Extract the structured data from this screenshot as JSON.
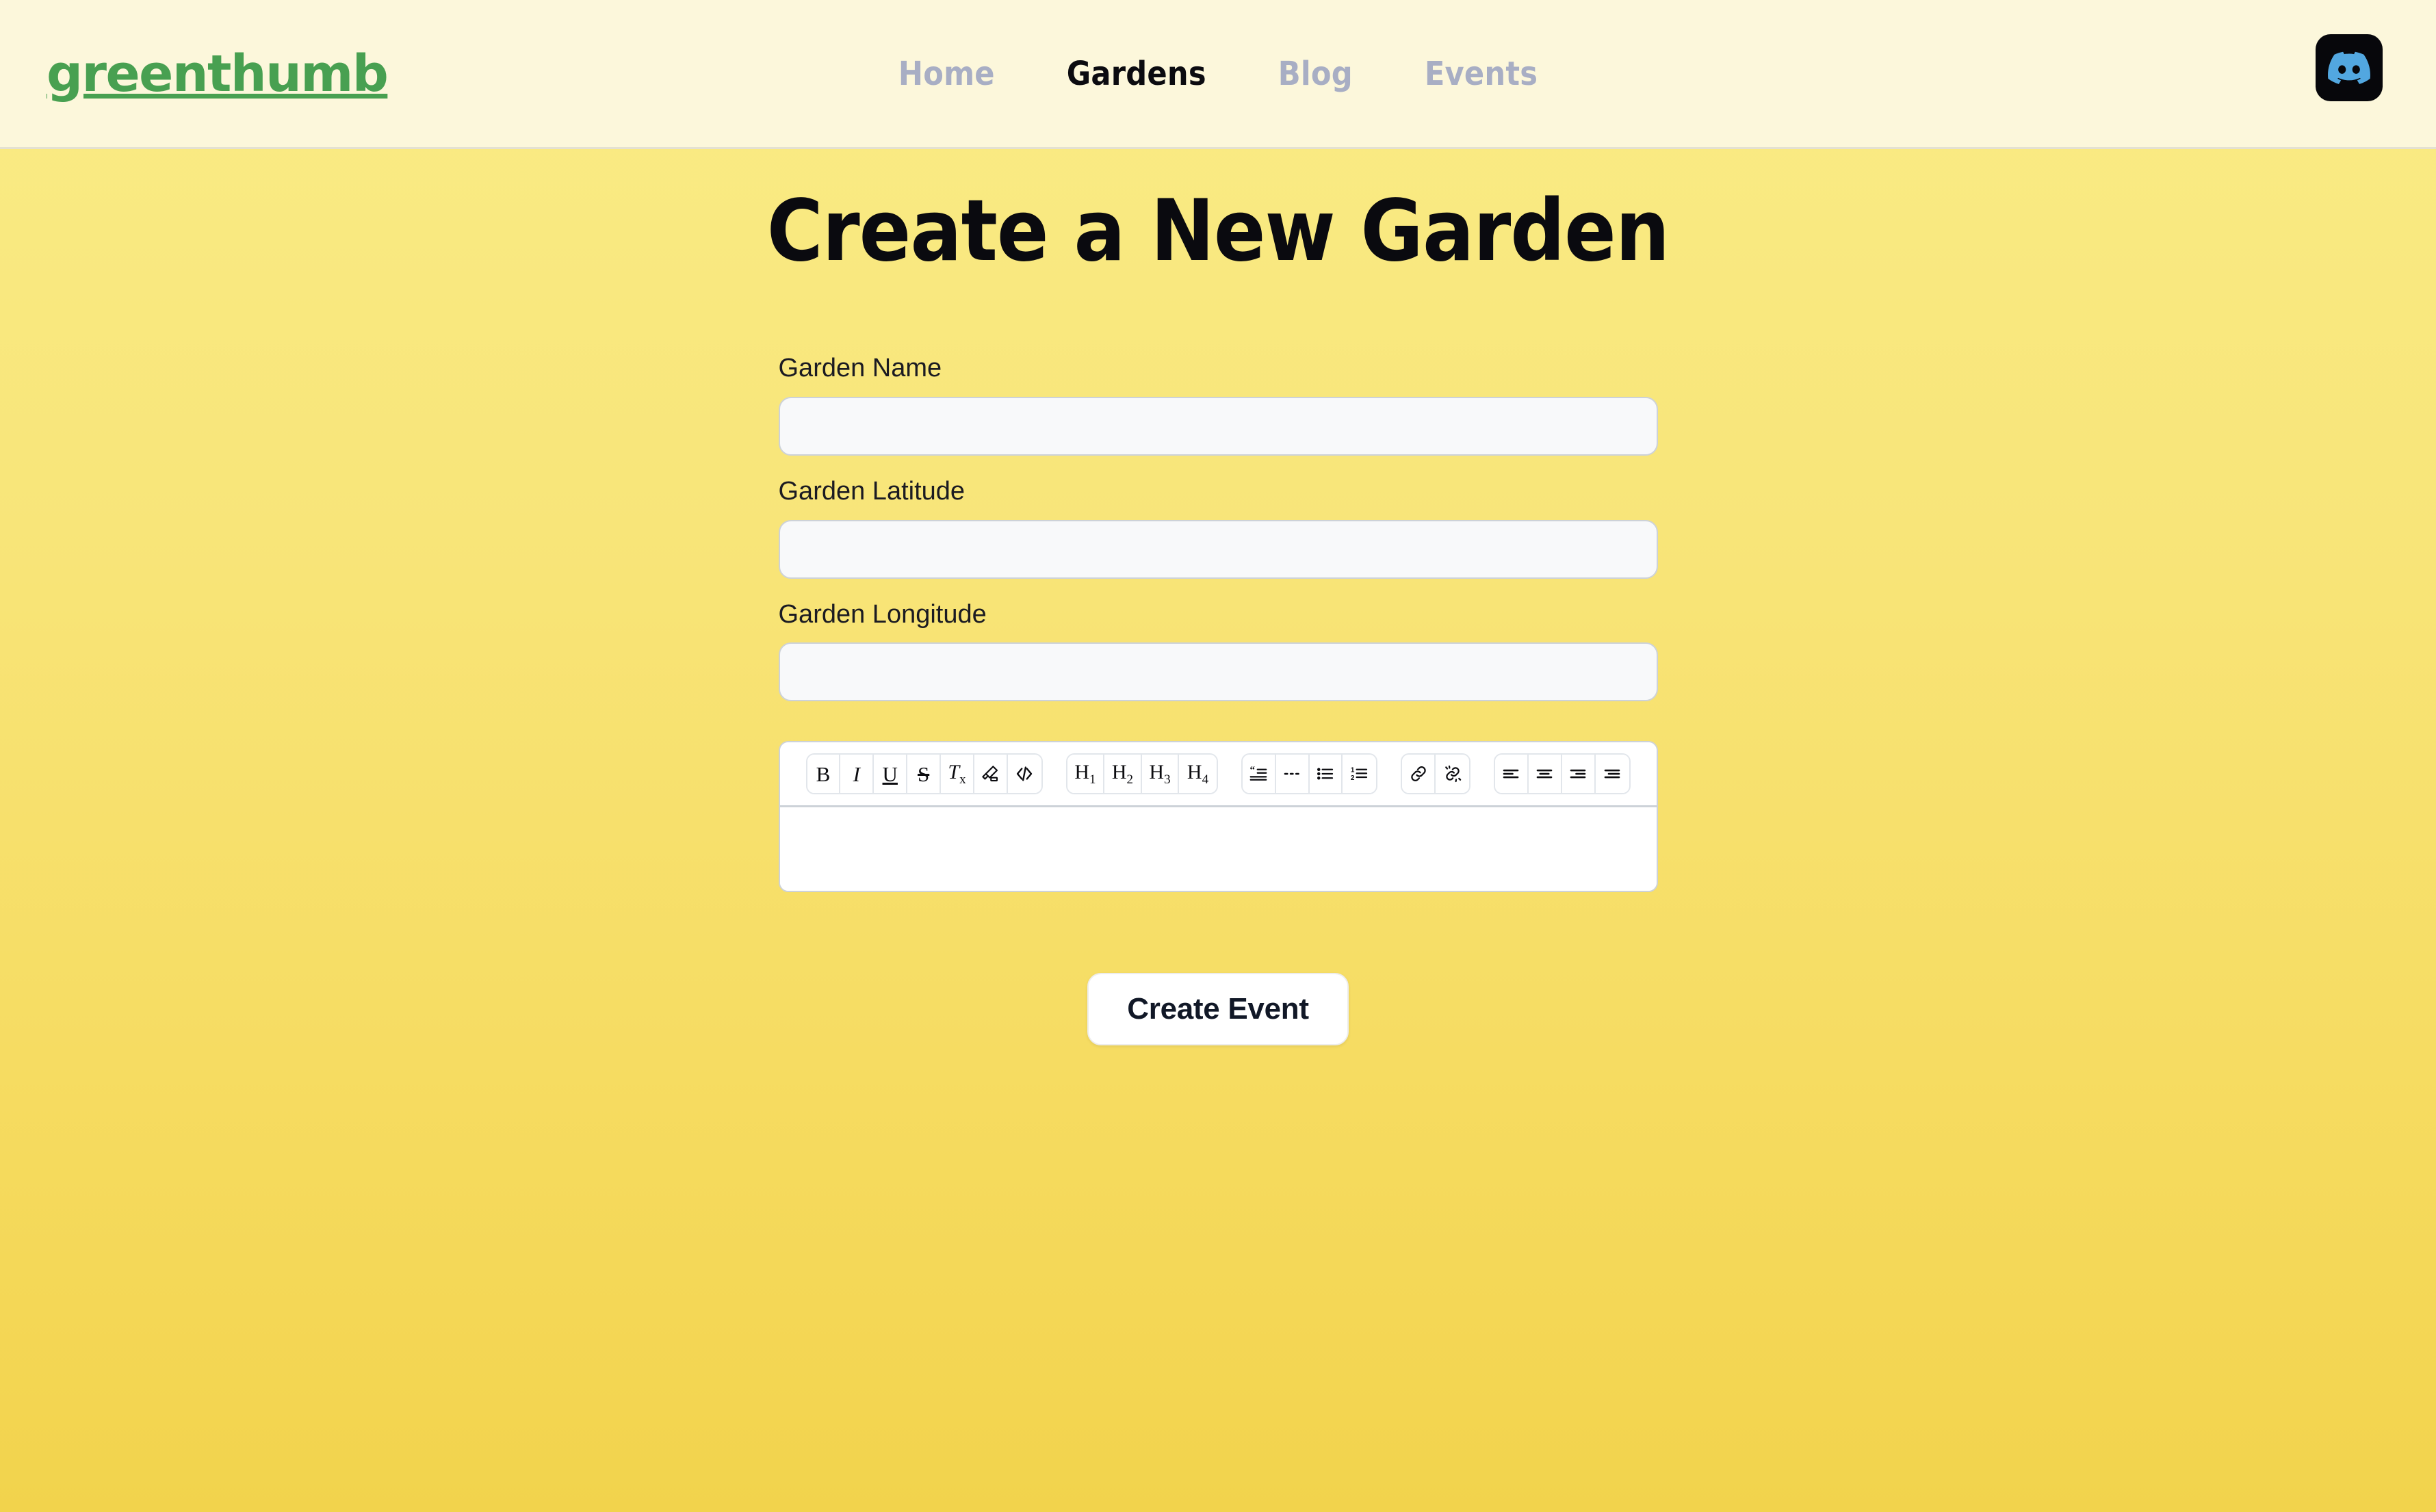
{
  "header": {
    "brand": "greenthumb",
    "nav": [
      {
        "label": "Home",
        "active": false
      },
      {
        "label": "Gardens",
        "active": true
      },
      {
        "label": "Blog",
        "active": false
      },
      {
        "label": "Events",
        "active": false
      }
    ],
    "avatar": {
      "icon": "discord-icon",
      "badge_bg": "#07070B",
      "logo_color": "#52A7E0"
    },
    "bg_color": "#FCF7DB"
  },
  "main": {
    "title": "Create a New Garden",
    "background_top": "#FAEC86",
    "background_bottom": "#F2D34C",
    "form": {
      "fields": [
        {
          "label": "Garden Name",
          "value": "",
          "placeholder": ""
        },
        {
          "label": "Garden Latitude",
          "value": "",
          "placeholder": ""
        },
        {
          "label": "Garden Longitude",
          "value": "",
          "placeholder": ""
        }
      ],
      "editor": {
        "content": "",
        "toolbar_groups": [
          {
            "name": "text-format",
            "buttons": [
              {
                "icon": "bold-icon",
                "label": "B"
              },
              {
                "icon": "italic-icon",
                "label": "I"
              },
              {
                "icon": "underline-icon",
                "label": "U"
              },
              {
                "icon": "strikethrough-icon",
                "label": "S"
              },
              {
                "icon": "clear-format-icon",
                "label": "Tx"
              },
              {
                "icon": "highlighter-icon",
                "label": ""
              },
              {
                "icon": "code-icon",
                "label": "</>"
              }
            ]
          },
          {
            "name": "headings",
            "buttons": [
              {
                "icon": "heading-1-icon",
                "label": "H1"
              },
              {
                "icon": "heading-2-icon",
                "label": "H2"
              },
              {
                "icon": "heading-3-icon",
                "label": "H3"
              },
              {
                "icon": "heading-4-icon",
                "label": "H4"
              }
            ]
          },
          {
            "name": "blocks",
            "buttons": [
              {
                "icon": "blockquote-icon",
                "label": ""
              },
              {
                "icon": "horizontal-rule-icon",
                "label": ""
              },
              {
                "icon": "bullet-list-icon",
                "label": ""
              },
              {
                "icon": "numbered-list-icon",
                "label": ""
              }
            ]
          },
          {
            "name": "links",
            "buttons": [
              {
                "icon": "link-icon",
                "label": ""
              },
              {
                "icon": "unlink-icon",
                "label": ""
              }
            ]
          },
          {
            "name": "alignment",
            "buttons": [
              {
                "icon": "align-left-icon",
                "label": ""
              },
              {
                "icon": "align-center-icon",
                "label": ""
              },
              {
                "icon": "align-right-icon",
                "label": ""
              },
              {
                "icon": "align-justify-icon",
                "label": ""
              }
            ]
          }
        ]
      },
      "submit_label": "Create Event"
    }
  }
}
